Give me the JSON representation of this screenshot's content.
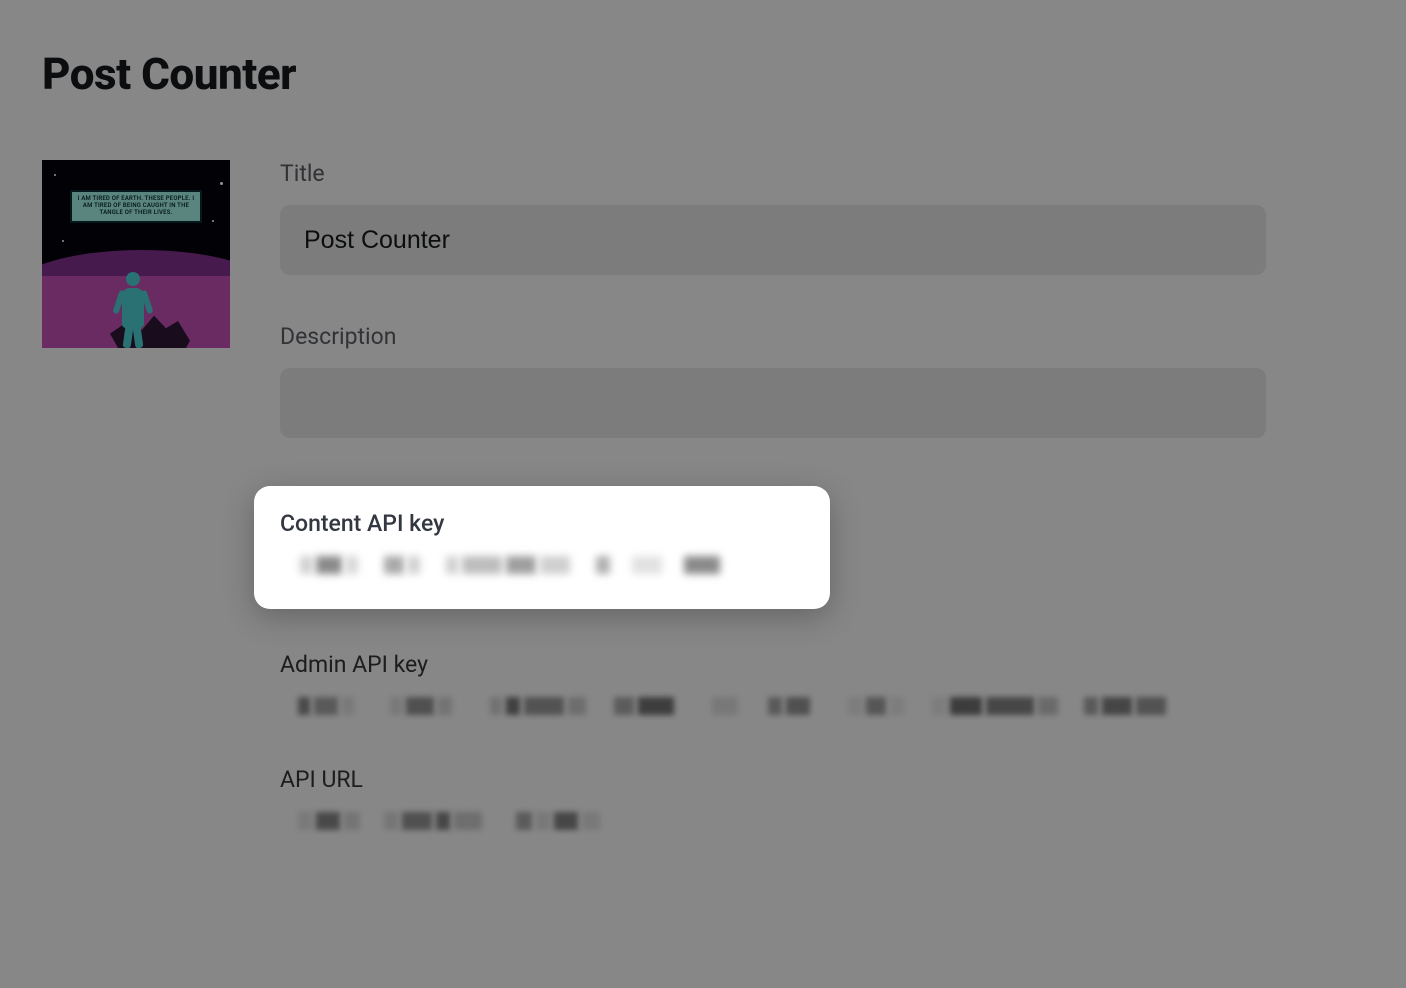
{
  "page": {
    "heading": "Post Counter"
  },
  "thumb": {
    "caption": "I AM TIRED OF EARTH. THESE PEOPLE. I AM TIRED OF BEING CAUGHT IN THE TANGLE OF THEIR LIVES."
  },
  "form": {
    "title": {
      "label": "Title",
      "value": "Post Counter"
    },
    "description": {
      "label": "Description",
      "value": ""
    }
  },
  "api": {
    "content_key": {
      "label": "Content API key",
      "value_redacted": true
    },
    "admin_key": {
      "label": "Admin API key",
      "value_redacted": true
    },
    "api_url": {
      "label": "API URL",
      "value_redacted": true
    }
  }
}
